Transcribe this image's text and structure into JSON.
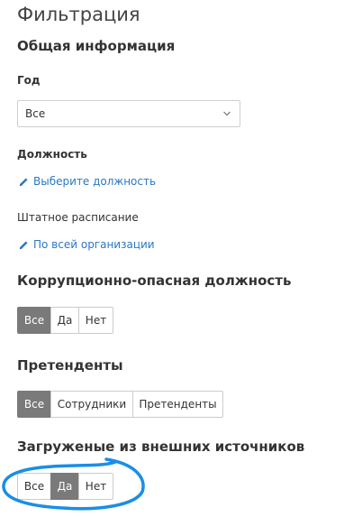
{
  "page": {
    "title": "Фильтрация"
  },
  "general": {
    "section_title": "Общая информация",
    "year": {
      "label": "Год",
      "selected": "Все"
    },
    "position": {
      "label": "Должность",
      "link_text": "Выберите должность"
    },
    "staffing": {
      "label": "Штатное расписание",
      "link_text": "По всей организации"
    }
  },
  "corruption": {
    "title": "Коррупционно-опасная должность",
    "options": [
      "Все",
      "Да",
      "Нет"
    ],
    "selected": "Все"
  },
  "candidates": {
    "title": "Претенденты",
    "options": [
      "Все",
      "Сотрудники",
      "Претенденты"
    ],
    "selected": "Все"
  },
  "external": {
    "title": "Загруженые из внешних источников",
    "options": [
      "Все",
      "Да",
      "Нет"
    ],
    "selected": "Да"
  },
  "colors": {
    "link": "#2b78c5",
    "active_segment": "#7a7a7a",
    "highlight_ellipse": "#1a8ee6"
  }
}
